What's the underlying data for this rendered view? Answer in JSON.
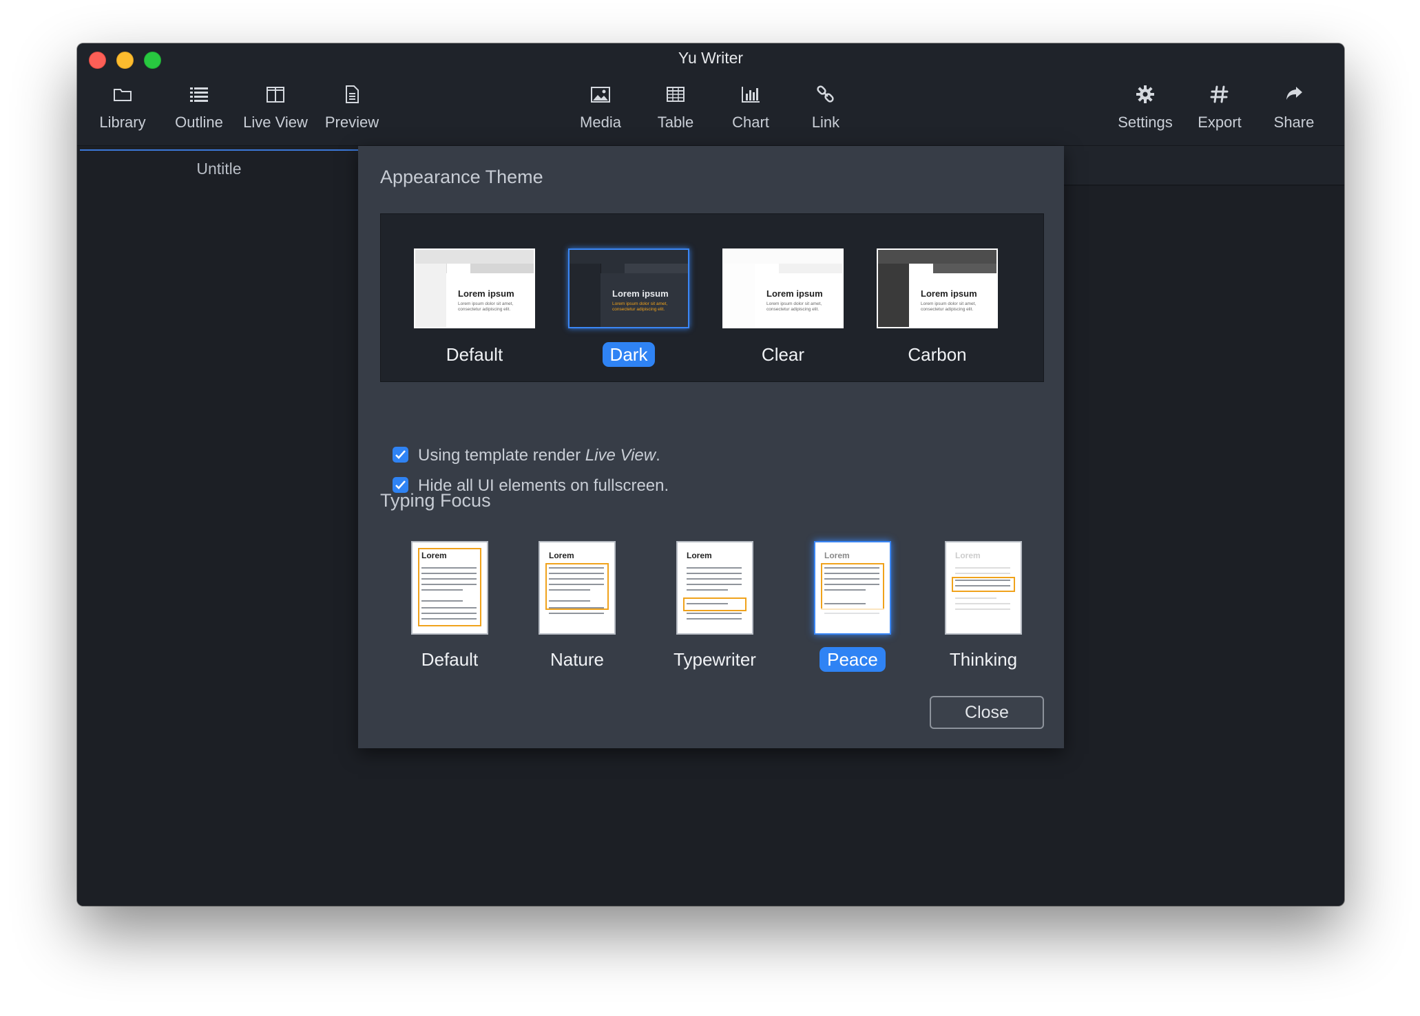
{
  "window": {
    "title": "Yu Writer"
  },
  "toolbar": {
    "left": [
      {
        "label": "Library",
        "icon": "folder-icon"
      },
      {
        "label": "Outline",
        "icon": "list-icon"
      },
      {
        "label": "Live View",
        "icon": "columns-icon"
      },
      {
        "label": "Preview",
        "icon": "document-icon"
      }
    ],
    "center": [
      {
        "label": "Media",
        "icon": "image-icon"
      },
      {
        "label": "Table",
        "icon": "table-icon"
      },
      {
        "label": "Chart",
        "icon": "chart-icon"
      },
      {
        "label": "Link",
        "icon": "link-icon"
      }
    ],
    "right": [
      {
        "label": "Settings",
        "icon": "gear-icon"
      },
      {
        "label": "Export",
        "icon": "hash-icon"
      },
      {
        "label": "Share",
        "icon": "share-icon"
      }
    ]
  },
  "sidebar": {
    "document_title": "Untitle"
  },
  "dialog": {
    "appearance_title": "Appearance Theme",
    "themes": [
      {
        "label": "Default",
        "preview_heading": "Lorem ipsum",
        "preview_text": "Lorem ipsum dolor sit amet, consectetur adipiscing elit.",
        "selected": false
      },
      {
        "label": "Dark",
        "preview_heading": "Lorem ipsum",
        "preview_text": "Lorem ipsum dolor sit amet, consectetur adipiscing elit.",
        "selected": true
      },
      {
        "label": "Clear",
        "preview_heading": "Lorem ipsum",
        "preview_text": "Lorem ipsum dolor sit amet, consectetur adipiscing elit.",
        "selected": false
      },
      {
        "label": "Carbon",
        "preview_heading": "Lorem ipsum",
        "preview_text": "Lorem ipsum dolor sit amet, consectetur adipiscing elit.",
        "selected": false
      }
    ],
    "options": [
      {
        "text_before": "Using template render ",
        "text_italic": "Live View",
        "text_after": ".",
        "checked": true
      },
      {
        "text_before": "Hide all UI elements on fullscreen.",
        "text_italic": "",
        "text_after": "",
        "checked": true
      }
    ],
    "typing_focus_title": "Typing Focus",
    "focus_modes": [
      {
        "label": "Default",
        "preview_heading": "Lorem",
        "selected": false
      },
      {
        "label": "Nature",
        "preview_heading": "Lorem",
        "selected": false
      },
      {
        "label": "Typewriter",
        "preview_heading": "Lorem",
        "selected": false
      },
      {
        "label": "Peace",
        "preview_heading": "Lorem",
        "selected": true
      },
      {
        "label": "Thinking",
        "preview_heading": "Lorem",
        "selected": false
      }
    ],
    "close_label": "Close"
  },
  "colors": {
    "accent": "#2f83f4",
    "window_bg": "#1c1f25",
    "sheet_bg": "#373d47",
    "focus_frame": "#f0a21b"
  }
}
